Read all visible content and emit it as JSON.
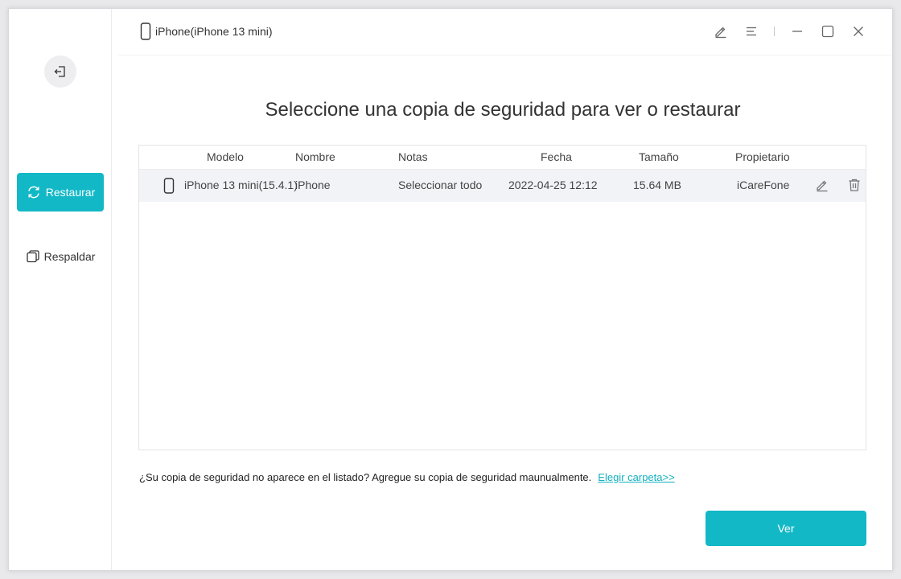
{
  "titlebar": {
    "device_name": "iPhone(iPhone 13 mini)",
    "icons": [
      "edit-icon",
      "menu-icon",
      "minimize-icon",
      "maximize-icon",
      "close-icon"
    ]
  },
  "sidebar": {
    "back_icon": "back-exit-icon",
    "items": [
      {
        "label": "Restaurar",
        "icon": "restore-icon",
        "active": true
      },
      {
        "label": "Respaldar",
        "icon": "backup-icon",
        "active": false
      }
    ]
  },
  "main": {
    "heading": "Seleccione una copia de seguridad para ver o restaurar",
    "table": {
      "columns": [
        "Modelo",
        "Nombre",
        "Notas",
        "Fecha",
        "Tamaño",
        "Propietario"
      ],
      "rows": [
        {
          "model": "iPhone 13 mini(15.4.1)",
          "name": "iPhone",
          "notes": "Seleccionar todo",
          "date": "2022-04-25 12:12",
          "size": "15.64 MB",
          "owner": "iCareFone"
        }
      ]
    },
    "note_text": "¿Su copia de seguridad no aparece en el listado? Agregue su copia de seguridad maunualmente.",
    "choose_folder_link": "Elegir carpeta>>",
    "view_button": "Ver"
  },
  "colors": {
    "accent": "#12b8c6",
    "row_bg": "#f2f3f7",
    "link": "#12b0c0"
  }
}
